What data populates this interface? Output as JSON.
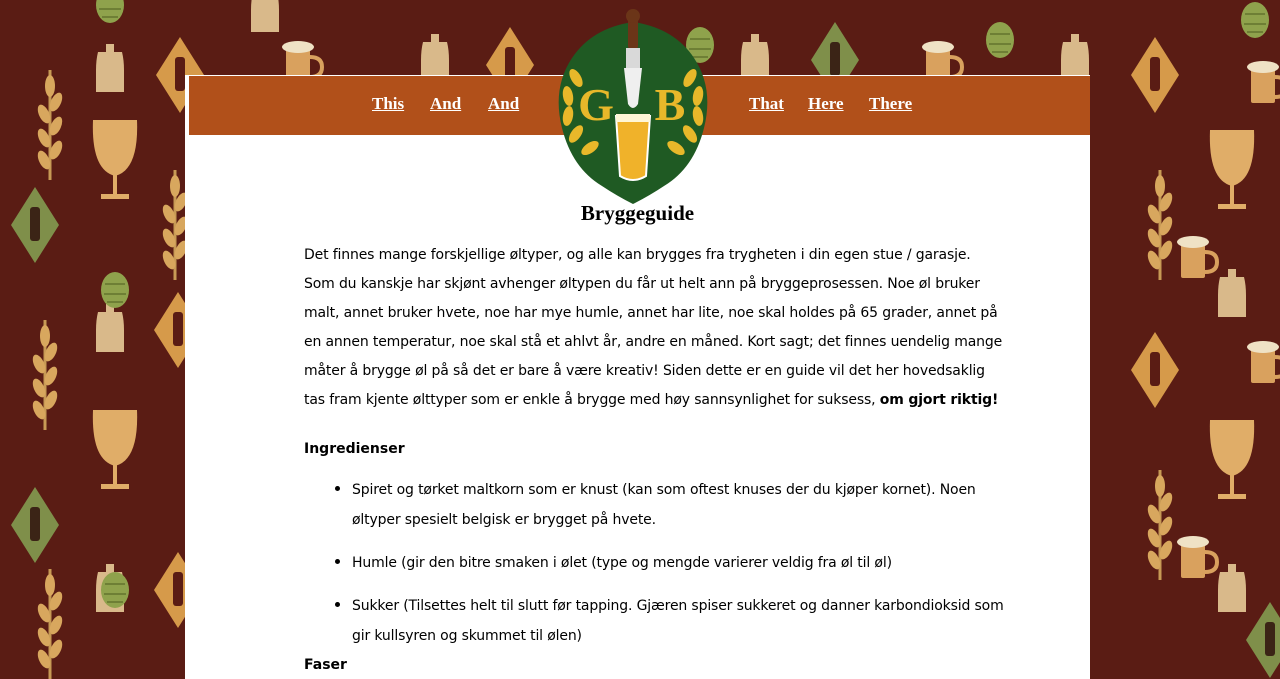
{
  "nav": {
    "left": [
      "This",
      "And",
      "And"
    ],
    "right": [
      "That",
      "Here",
      "There"
    ]
  },
  "logo": {
    "letters": [
      "G",
      "B"
    ],
    "icon": "beer-tap-glass-logo"
  },
  "page_title": "Bryggeguide",
  "intro": {
    "text": "Det finnes mange forskjellige øltyper, og alle kan brygges fra trygheten i din egen stue / garasje. Som du kanskje har skjønt avhenger øltypen du får ut helt ann på bryggeprosessen. Noe øl bruker malt, annet bruker hvete, noe har mye humle, annet har lite, noe skal holdes på 65 grader, annet på en annen temperatur, noe skal stå et ahlvt år, andre en måned. Kort sagt; det finnes uendelig mange måter å brygge øl på så det er bare å være kreativ! Siden dette er en guide vil det her hovedsaklig tas fram kjente ølttyper som er enkle å brygge med høy sannsynlighet for suksess,",
    "emphasis": "om gjort riktig!"
  },
  "ingredients": {
    "heading": "Ingredienser",
    "items": [
      "Spiret og tørket maltkorn som er knust (kan som oftest knuses der du kjøper kornet). Noen øltyper spesielt belgisk er brygget på hvete.",
      "Humle (gir den bitre smaken i ølet (type og mengde varierer veldig fra øl til øl)",
      "Sukker (Tilsettes helt til slutt før tapping. Gjæren spiser sukkeret og danner karbondioksid som gir kullsyren og skummet til ølen)"
    ]
  },
  "phases_heading": "Faser",
  "colors": {
    "background": "#5a1c14",
    "nav": "#b1501a",
    "logo_green": "#1f5a23",
    "gold": "#e8b82a"
  }
}
